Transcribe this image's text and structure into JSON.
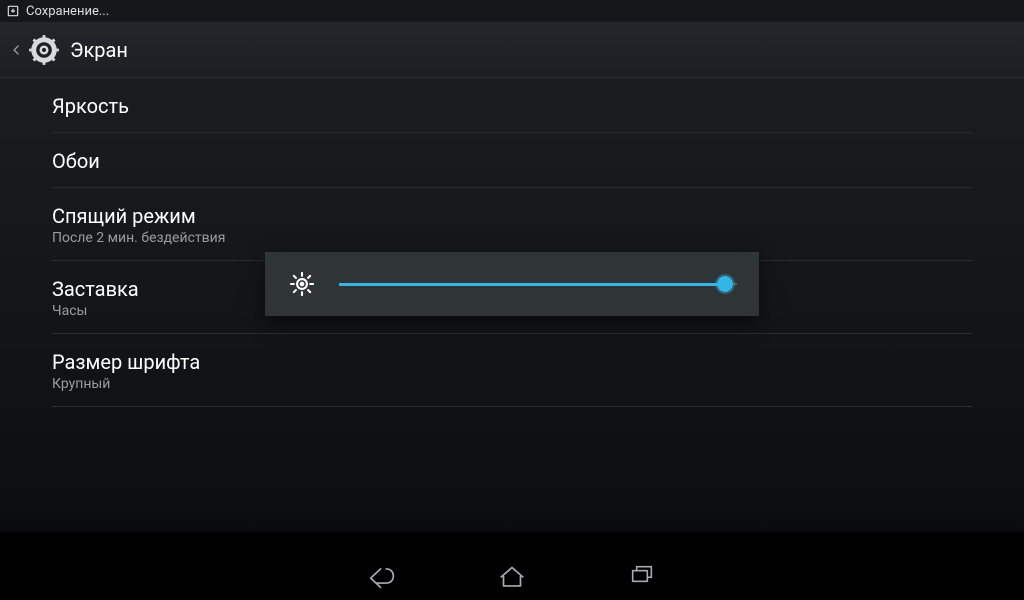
{
  "status": {
    "text": "Сохранение..."
  },
  "header": {
    "title": "Экран"
  },
  "settings": {
    "brightness": {
      "title": "Яркость"
    },
    "wallpaper": {
      "title": "Обои"
    },
    "sleep": {
      "title": "Спящий режим",
      "subtitle": "После 2 мин. бездействия"
    },
    "daydream": {
      "title": "Заставка",
      "subtitle": "Часы"
    },
    "font_size": {
      "title": "Размер шрифта",
      "subtitle": "Крупный"
    }
  },
  "dialog": {
    "brightness_percent": 97
  },
  "colors": {
    "accent": "#33b5e5"
  }
}
